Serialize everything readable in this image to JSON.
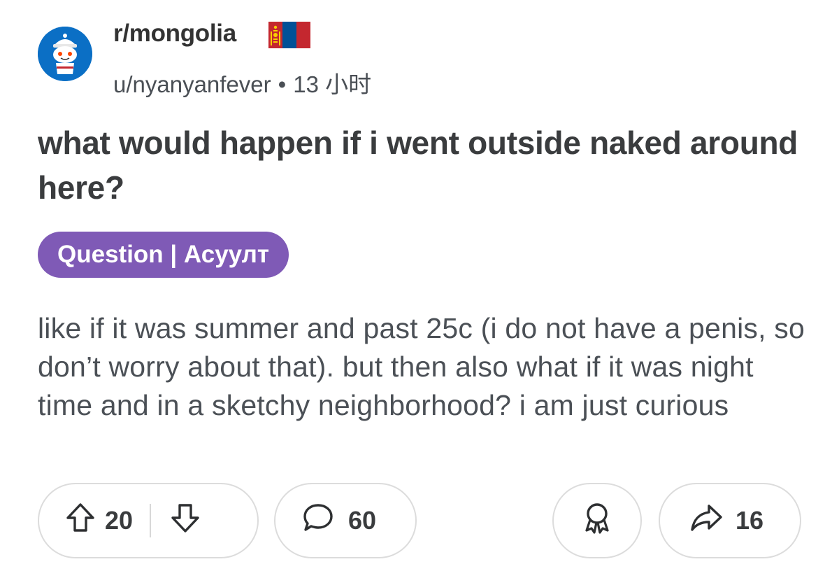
{
  "post": {
    "subreddit": "r/mongolia",
    "author": "u/nyanyanfever",
    "separator": "•",
    "age": "13 小时",
    "title": "what would happen if i went outside naked around here?",
    "flair": "Question | Асуулт",
    "body": "like if it was summer and past 25c (i do not have a penis, so don’t worry about that). but then also what if it was night time and in a sketchy neighborhood? i am just curious"
  },
  "actions": {
    "upvotes": "20",
    "comments": "60",
    "shares": "16"
  },
  "colors": {
    "flair_bg": "#7f5ab6",
    "avatar_bg": "#0b6fc5",
    "flag_red": "#c4272f",
    "flag_blue": "#015197",
    "flag_yellow": "#f9cf02"
  },
  "icons": {
    "avatar": "snoo-avatar-icon",
    "flag": "mongolia-flag-icon",
    "upvote": "upvote-arrow-icon",
    "downvote": "downvote-arrow-icon",
    "comment": "comment-bubble-icon",
    "award": "award-icon",
    "share": "share-arrow-icon"
  }
}
